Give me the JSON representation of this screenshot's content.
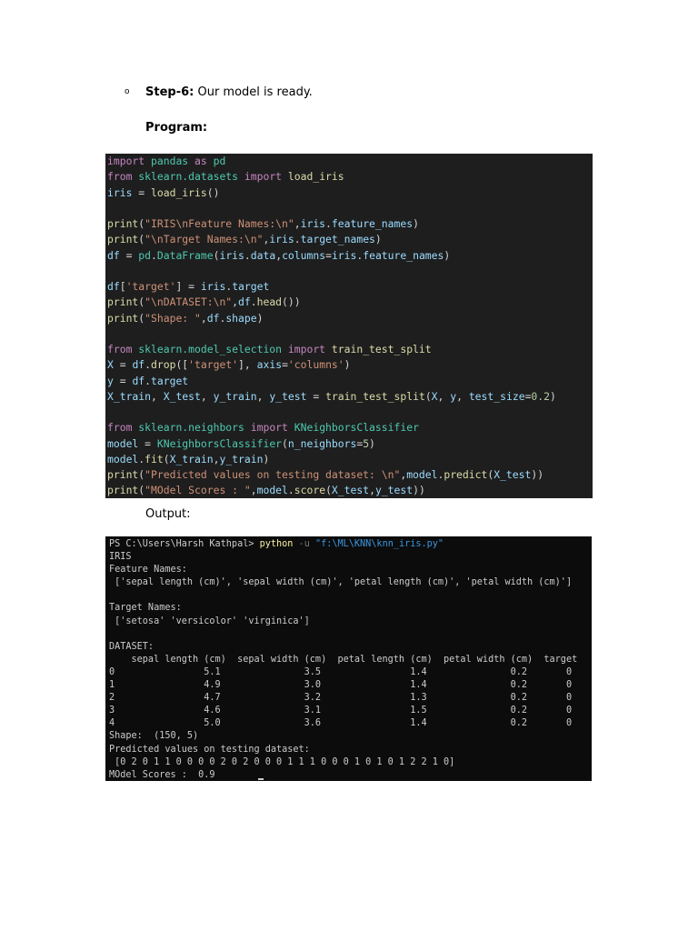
{
  "step": {
    "bullet": "o",
    "label": "Step-6:",
    "text": " Our model is ready."
  },
  "program_heading": "Program:",
  "output_label": "Output:",
  "colors": {
    "keyword": "#c586c0",
    "variable": "#9cdcfe",
    "function": "#dcdcaa",
    "string": "#ce9178",
    "number": "#b5cea8",
    "class": "#4ec9b0",
    "plain": "#d4d4d4",
    "prompt": "#cccccc",
    "command": "#f9f1a5",
    "flag": "#767676",
    "path_arg": "#3a96dd"
  },
  "code": [
    [
      [
        "import",
        "keyword"
      ],
      [
        " ",
        "plain"
      ],
      [
        "pandas",
        "class"
      ],
      [
        " ",
        "plain"
      ],
      [
        "as",
        "keyword"
      ],
      [
        " ",
        "plain"
      ],
      [
        "pd",
        "class"
      ]
    ],
    [
      [
        "from",
        "keyword"
      ],
      [
        " ",
        "plain"
      ],
      [
        "sklearn.datasets",
        "class"
      ],
      [
        " ",
        "plain"
      ],
      [
        "import",
        "keyword"
      ],
      [
        " ",
        "plain"
      ],
      [
        "load_iris",
        "function"
      ]
    ],
    [
      [
        "iris",
        "variable"
      ],
      [
        " = ",
        "plain"
      ],
      [
        "load_iris",
        "function"
      ],
      [
        "()",
        "plain"
      ]
    ],
    [],
    [
      [
        "print",
        "function"
      ],
      [
        "(",
        "plain"
      ],
      [
        "\"IRIS\\nFeature Names:\\n\"",
        "string"
      ],
      [
        ",",
        "plain"
      ],
      [
        "iris",
        "variable"
      ],
      [
        ".",
        "plain"
      ],
      [
        "feature_names",
        "variable"
      ],
      [
        ")",
        "plain"
      ]
    ],
    [
      [
        "print",
        "function"
      ],
      [
        "(",
        "plain"
      ],
      [
        "\"\\nTarget Names:\\n\"",
        "string"
      ],
      [
        ",",
        "plain"
      ],
      [
        "iris",
        "variable"
      ],
      [
        ".",
        "plain"
      ],
      [
        "target_names",
        "variable"
      ],
      [
        ")",
        "plain"
      ]
    ],
    [
      [
        "df",
        "variable"
      ],
      [
        " = ",
        "plain"
      ],
      [
        "pd",
        "class"
      ],
      [
        ".",
        "plain"
      ],
      [
        "DataFrame",
        "class"
      ],
      [
        "(",
        "plain"
      ],
      [
        "iris",
        "variable"
      ],
      [
        ".",
        "plain"
      ],
      [
        "data",
        "variable"
      ],
      [
        ",",
        "plain"
      ],
      [
        "columns",
        "variable"
      ],
      [
        "=",
        "plain"
      ],
      [
        "iris",
        "variable"
      ],
      [
        ".",
        "plain"
      ],
      [
        "feature_names",
        "variable"
      ],
      [
        ")",
        "plain"
      ]
    ],
    [],
    [
      [
        "df",
        "variable"
      ],
      [
        "[",
        "plain"
      ],
      [
        "'target'",
        "string"
      ],
      [
        "] = ",
        "plain"
      ],
      [
        "iris",
        "variable"
      ],
      [
        ".",
        "plain"
      ],
      [
        "target",
        "variable"
      ]
    ],
    [
      [
        "print",
        "function"
      ],
      [
        "(",
        "plain"
      ],
      [
        "\"\\nDATASET:\\n\"",
        "string"
      ],
      [
        ",",
        "plain"
      ],
      [
        "df",
        "variable"
      ],
      [
        ".",
        "plain"
      ],
      [
        "head",
        "function"
      ],
      [
        "())",
        "plain"
      ]
    ],
    [
      [
        "print",
        "function"
      ],
      [
        "(",
        "plain"
      ],
      [
        "\"Shape: \"",
        "string"
      ],
      [
        ",",
        "plain"
      ],
      [
        "df",
        "variable"
      ],
      [
        ".",
        "plain"
      ],
      [
        "shape",
        "variable"
      ],
      [
        ")",
        "plain"
      ]
    ],
    [],
    [
      [
        "from",
        "keyword"
      ],
      [
        " ",
        "plain"
      ],
      [
        "sklearn.model_selection",
        "class"
      ],
      [
        " ",
        "plain"
      ],
      [
        "import",
        "keyword"
      ],
      [
        " ",
        "plain"
      ],
      [
        "train_test_split",
        "function"
      ]
    ],
    [
      [
        "X",
        "variable"
      ],
      [
        " = ",
        "plain"
      ],
      [
        "df",
        "variable"
      ],
      [
        ".",
        "plain"
      ],
      [
        "drop",
        "function"
      ],
      [
        "([",
        "plain"
      ],
      [
        "'target'",
        "string"
      ],
      [
        "], ",
        "plain"
      ],
      [
        "axis",
        "variable"
      ],
      [
        "=",
        "plain"
      ],
      [
        "'columns'",
        "string"
      ],
      [
        ")",
        "plain"
      ]
    ],
    [
      [
        "y",
        "variable"
      ],
      [
        " = ",
        "plain"
      ],
      [
        "df",
        "variable"
      ],
      [
        ".",
        "plain"
      ],
      [
        "target",
        "variable"
      ]
    ],
    [
      [
        "X_train",
        "variable"
      ],
      [
        ", ",
        "plain"
      ],
      [
        "X_test",
        "variable"
      ],
      [
        ", ",
        "plain"
      ],
      [
        "y_train",
        "variable"
      ],
      [
        ", ",
        "plain"
      ],
      [
        "y_test",
        "variable"
      ],
      [
        " = ",
        "plain"
      ],
      [
        "train_test_split",
        "function"
      ],
      [
        "(",
        "plain"
      ],
      [
        "X",
        "variable"
      ],
      [
        ", ",
        "plain"
      ],
      [
        "y",
        "variable"
      ],
      [
        ", ",
        "plain"
      ],
      [
        "test_size",
        "variable"
      ],
      [
        "=",
        "plain"
      ],
      [
        "0.2",
        "number"
      ],
      [
        ")",
        "plain"
      ]
    ],
    [],
    [
      [
        "from",
        "keyword"
      ],
      [
        " ",
        "plain"
      ],
      [
        "sklearn.neighbors",
        "class"
      ],
      [
        " ",
        "plain"
      ],
      [
        "import",
        "keyword"
      ],
      [
        " ",
        "plain"
      ],
      [
        "KNeighborsClassifier",
        "class"
      ]
    ],
    [
      [
        "model",
        "variable"
      ],
      [
        " = ",
        "plain"
      ],
      [
        "KNeighborsClassifier",
        "class"
      ],
      [
        "(",
        "plain"
      ],
      [
        "n_neighbors",
        "variable"
      ],
      [
        "=",
        "plain"
      ],
      [
        "5",
        "number"
      ],
      [
        ")",
        "plain"
      ]
    ],
    [
      [
        "model",
        "variable"
      ],
      [
        ".",
        "plain"
      ],
      [
        "fit",
        "function"
      ],
      [
        "(",
        "plain"
      ],
      [
        "X_train",
        "variable"
      ],
      [
        ",",
        "plain"
      ],
      [
        "y_train",
        "variable"
      ],
      [
        ")",
        "plain"
      ]
    ],
    [
      [
        "print",
        "function"
      ],
      [
        "(",
        "plain"
      ],
      [
        "\"Predicted values on testing dataset: \\n\"",
        "string"
      ],
      [
        ",",
        "plain"
      ],
      [
        "model",
        "variable"
      ],
      [
        ".",
        "plain"
      ],
      [
        "predict",
        "function"
      ],
      [
        "(",
        "plain"
      ],
      [
        "X_test",
        "variable"
      ],
      [
        "))",
        "plain"
      ]
    ],
    [
      [
        "print",
        "function"
      ],
      [
        "(",
        "plain"
      ],
      [
        "\"MOdel Scores : \"",
        "string"
      ],
      [
        ",",
        "plain"
      ],
      [
        "model",
        "variable"
      ],
      [
        ".",
        "plain"
      ],
      [
        "score",
        "function"
      ],
      [
        "(",
        "plain"
      ],
      [
        "X_test",
        "variable"
      ],
      [
        ",",
        "plain"
      ],
      [
        "y_test",
        "variable"
      ],
      [
        "))",
        "plain"
      ]
    ]
  ],
  "terminal": [
    [
      [
        "PS C:\\Users\\Harsh Kathpal> ",
        "prompt"
      ],
      [
        "python",
        "command"
      ],
      [
        " -u ",
        "flag"
      ],
      [
        "\"f:\\ML\\KNN\\knn_iris.py\"",
        "path_arg"
      ]
    ],
    [
      [
        "IRIS",
        "prompt"
      ]
    ],
    [
      [
        "Feature Names:",
        "prompt"
      ]
    ],
    [
      [
        " ['sepal length (cm)', 'sepal width (cm)', 'petal length (cm)', 'petal width (cm)']",
        "prompt"
      ]
    ],
    [],
    [
      [
        "Target Names:",
        "prompt"
      ]
    ],
    [
      [
        " ['setosa' 'versicolor' 'virginica']",
        "prompt"
      ]
    ],
    [],
    [
      [
        "DATASET:",
        "prompt"
      ]
    ],
    [
      [
        "    sepal length (cm)  sepal width (cm)  petal length (cm)  petal width (cm)  target",
        "prompt"
      ]
    ],
    [
      [
        "0                5.1               3.5                1.4               0.2       0",
        "prompt"
      ]
    ],
    [
      [
        "1                4.9               3.0                1.4               0.2       0",
        "prompt"
      ]
    ],
    [
      [
        "2                4.7               3.2                1.3               0.2       0",
        "prompt"
      ]
    ],
    [
      [
        "3                4.6               3.1                1.5               0.2       0",
        "prompt"
      ]
    ],
    [
      [
        "4                5.0               3.6                1.4               0.2       0",
        "prompt"
      ]
    ],
    [
      [
        "Shape:  (150, 5)",
        "prompt"
      ]
    ],
    [
      [
        "Predicted values on testing dataset:",
        "prompt"
      ]
    ],
    [
      [
        " [0 2 0 1 1 0 0 0 0 2 0 2 0 0 0 1 1 1 0 0 0 1 0 1 0 1 2 2 1 0]",
        "prompt"
      ]
    ],
    [
      [
        "MOdel Scores :  0.9",
        "prompt"
      ]
    ]
  ]
}
